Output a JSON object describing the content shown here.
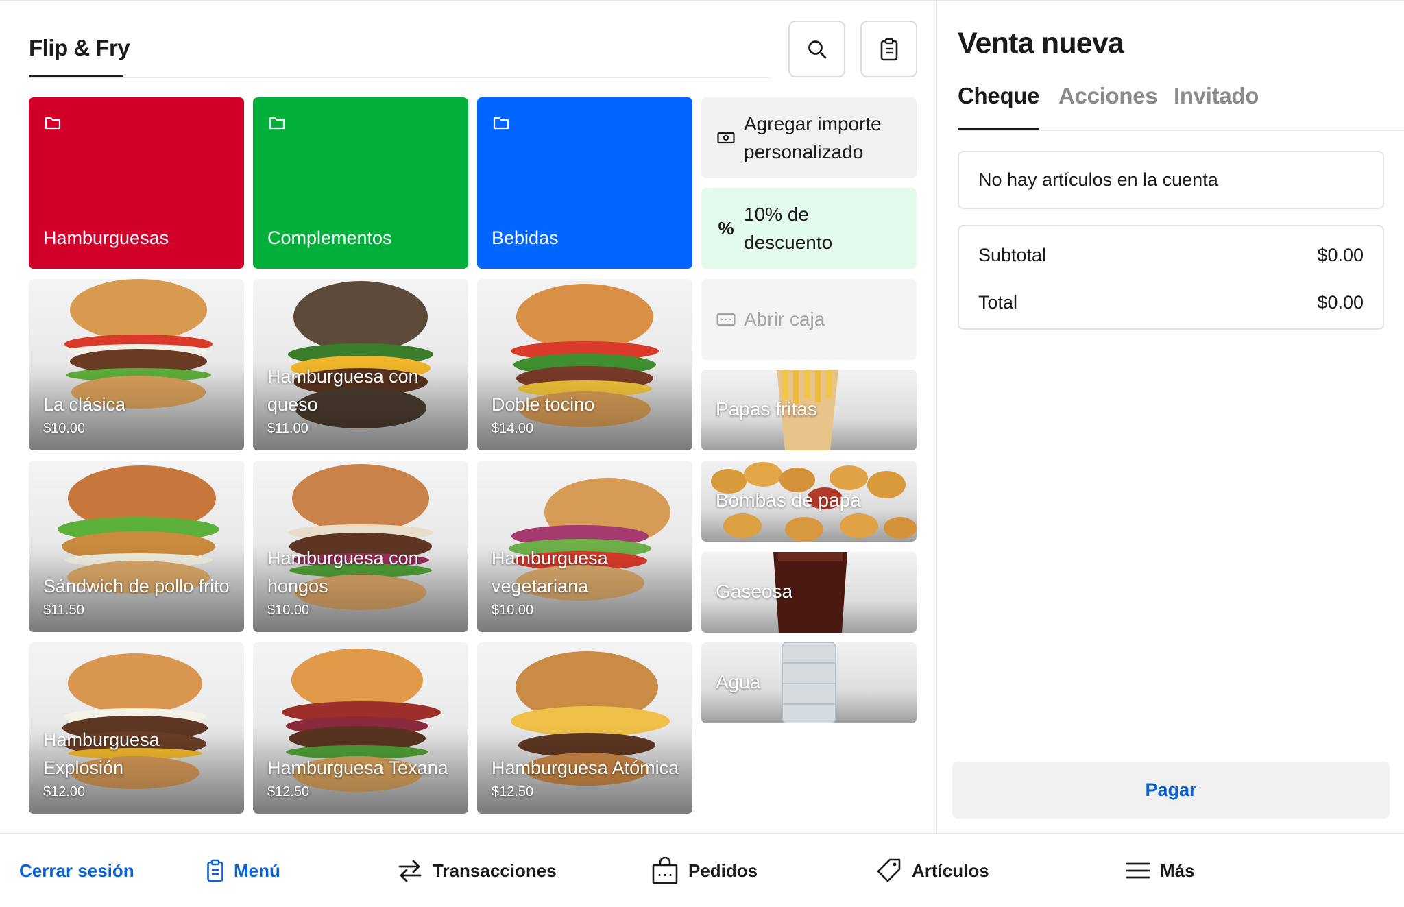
{
  "header": {
    "brand": "Flip & Fry",
    "search_icon": "search-icon",
    "clipboard_icon": "clipboard-icon"
  },
  "categories": [
    {
      "label": "Hamburguesas",
      "color": "#d1002a",
      "icon": "folder-icon"
    },
    {
      "label": "Complementos",
      "color": "#00b03b",
      "icon": "folder-icon"
    },
    {
      "label": "Bebidas",
      "color": "#0066ff",
      "icon": "folder-icon"
    }
  ],
  "items": [
    {
      "name": "La clásica",
      "price": "$10.00"
    },
    {
      "name": "Hamburguesa con queso",
      "price": "$11.00"
    },
    {
      "name": "Doble tocino",
      "price": "$14.00"
    },
    {
      "name": "Sándwich de pollo frito",
      "price": "$11.50"
    },
    {
      "name": "Hamburguesa con hongos",
      "price": "$10.00"
    },
    {
      "name": "Hamburguesa vegetariana",
      "price": "$10.00"
    },
    {
      "name": "Hamburguesa Explosión",
      "price": "$12.00"
    },
    {
      "name": "Hamburguesa Texana",
      "price": "$12.50"
    },
    {
      "name": "Hamburguesa Atómica",
      "price": "$12.50"
    }
  ],
  "side_actions": {
    "custom_amount": {
      "label": "Agregar importe personalizado",
      "icon": "cash-icon"
    },
    "discount": {
      "label": "10% de descuento",
      "icon": "percent-icon",
      "color": "#e3fbec"
    },
    "open_drawer": {
      "label": "Abrir caja",
      "icon": "drawer-icon"
    }
  },
  "side_items": [
    {
      "name": "Papas fritas"
    },
    {
      "name": "Bombas de papa"
    },
    {
      "name": "Gaseosa"
    },
    {
      "name": "Agua"
    }
  ],
  "sale": {
    "title": "Venta nueva",
    "tabs": [
      "Cheque",
      "Acciones",
      "Invitado"
    ],
    "active_tab": "Cheque",
    "empty_message": "No hay artículos en la cuenta",
    "subtotal_label": "Subtotal",
    "subtotal_value": "$0.00",
    "total_label": "Total",
    "total_value": "$0.00",
    "pay_label": "Pagar"
  },
  "nav": {
    "logout": "Cerrar sesión",
    "menu": "Menú",
    "transactions": "Transacciones",
    "orders": "Pedidos",
    "articles": "Artículos",
    "more": "Más",
    "accent_color": "#0a63d8"
  }
}
